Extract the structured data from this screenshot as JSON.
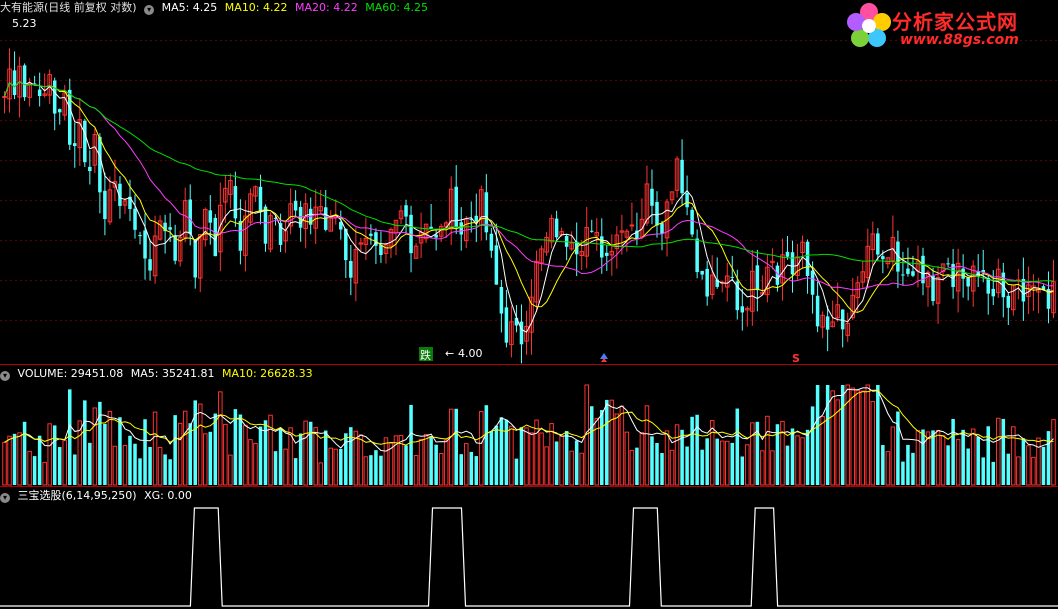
{
  "main_panel": {
    "title": "大有能源(日线 前复权 对数)",
    "indicators": [
      {
        "label": "MA5: 4.25",
        "color": "#ffffff"
      },
      {
        "label": "MA10: 4.22",
        "color": "#ffff00"
      },
      {
        "label": "MA20: 4.22",
        "color": "#ff3cff"
      },
      {
        "label": "MA60: 4.25",
        "color": "#00e000"
      }
    ],
    "high_label": "5.23",
    "low_label": "4.00",
    "signal_label": "跌",
    "signal_s_label": "S"
  },
  "volume_panel": {
    "indicators": [
      {
        "label": "VOLUME: 29451.08",
        "color": "#ffffff"
      },
      {
        "label": "MA5: 35241.81",
        "color": "#ffffff"
      },
      {
        "label": "MA10: 26628.33",
        "color": "#ffff00"
      }
    ]
  },
  "signal_panel": {
    "indicators": [
      {
        "label": "三宝选股(6,14,95,250)",
        "color": "#ffffff"
      },
      {
        "label": "XG: 0.00",
        "color": "#ffffff"
      }
    ]
  },
  "logo": {
    "name": "分析家公式网",
    "url": "www.88gs.com"
  },
  "colors": {
    "up": "#ff3232",
    "down": "#54ffff",
    "ma5": "#ffffff",
    "ma10": "#ffff00",
    "ma20": "#ff3cff",
    "ma60": "#00e000",
    "divider": "#b00000"
  },
  "chart_data": {
    "type": "candlestick",
    "ylim": [
      4.0,
      5.3
    ],
    "price_path": [
      5.0,
      5.1,
      5.05,
      5.15,
      5.0,
      5.05,
      5.1,
      4.95,
      5.0,
      5.1,
      4.95,
      4.9,
      5.0,
      4.85,
      4.8,
      4.95,
      4.7,
      4.75,
      4.85,
      4.6,
      4.55,
      4.7,
      4.6,
      4.5,
      4.65,
      4.55,
      4.4,
      4.5,
      4.35,
      4.3,
      4.45,
      4.55,
      4.5,
      4.4,
      4.35,
      4.5,
      4.6,
      4.45,
      4.3,
      4.45,
      4.6,
      4.5,
      4.4,
      4.55,
      4.7,
      4.6,
      4.5,
      4.4,
      4.55,
      4.65,
      4.6,
      4.5,
      4.45,
      4.6,
      4.5,
      4.45,
      4.55,
      4.6,
      4.5,
      4.45,
      4.55,
      4.5,
      4.6,
      4.55,
      4.45,
      4.5,
      4.55,
      4.45,
      4.35,
      4.3,
      4.4,
      4.5,
      4.45,
      4.4,
      4.35,
      4.3,
      4.4,
      4.45,
      4.5,
      4.55,
      4.5,
      4.4,
      4.45,
      4.5,
      4.55,
      4.45,
      4.4,
      4.5,
      4.55,
      4.6,
      4.5,
      4.45,
      4.55,
      4.5,
      4.6,
      4.55,
      4.4,
      4.3,
      4.2,
      4.1,
      4.05,
      4.1,
      4.0,
      4.1,
      4.2,
      4.3,
      4.35,
      4.4,
      4.45,
      4.5,
      4.45,
      4.4,
      4.5,
      4.45,
      4.4,
      4.5,
      4.45,
      4.4,
      4.45,
      4.35,
      4.4,
      4.5,
      4.45,
      4.5,
      4.55,
      4.45,
      4.5,
      4.6,
      4.65,
      4.55,
      4.5,
      4.55,
      4.6,
      4.8,
      4.7,
      4.6,
      4.5,
      4.4,
      4.3,
      4.2,
      4.25,
      4.3,
      4.2,
      4.25,
      4.3,
      4.2,
      4.15,
      4.2,
      4.25,
      4.3,
      4.25,
      4.35,
      4.4,
      4.3,
      4.35,
      4.4,
      4.3,
      4.35,
      4.4,
      4.3,
      4.25,
      4.15,
      4.1,
      4.05,
      4.1,
      4.15,
      4.05,
      4.1,
      4.15,
      4.2,
      4.3,
      4.4,
      4.45,
      4.35,
      4.3,
      4.35,
      4.4,
      4.3,
      4.25,
      4.3,
      4.35,
      4.3,
      4.25,
      4.3,
      4.2,
      4.25,
      4.3,
      4.35,
      4.25,
      4.3,
      4.25,
      4.3,
      4.35,
      4.3,
      4.25,
      4.2,
      4.25,
      4.3,
      4.25,
      4.2,
      4.25,
      4.3,
      4.25,
      4.2,
      4.25,
      4.3,
      4.25,
      4.2,
      4.25
    ],
    "signal_pulses": [
      {
        "start": 0.18,
        "end": 0.21
      },
      {
        "start": 0.405,
        "end": 0.44
      },
      {
        "start": 0.595,
        "end": 0.625
      },
      {
        "start": 0.71,
        "end": 0.735
      }
    ]
  }
}
